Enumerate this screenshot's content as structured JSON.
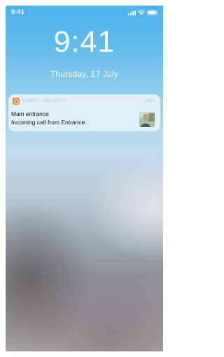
{
  "status_bar": {
    "time": "9:41",
    "signal_icon": "cellular-signal-icon",
    "wifi_icon": "wifi-icon",
    "battery_icon": "battery-icon"
  },
  "lock_screen": {
    "clock": "9:41",
    "date": "Thursday, 17 July"
  },
  "notification": {
    "app_icon": "shield-icon",
    "app_name": "HOME • SECURITY",
    "time": "now",
    "title": "Main entrance",
    "body": "Incoming call from Entrance.",
    "thumbnail": "visitor-photo",
    "accent_color": "#f0852d"
  }
}
